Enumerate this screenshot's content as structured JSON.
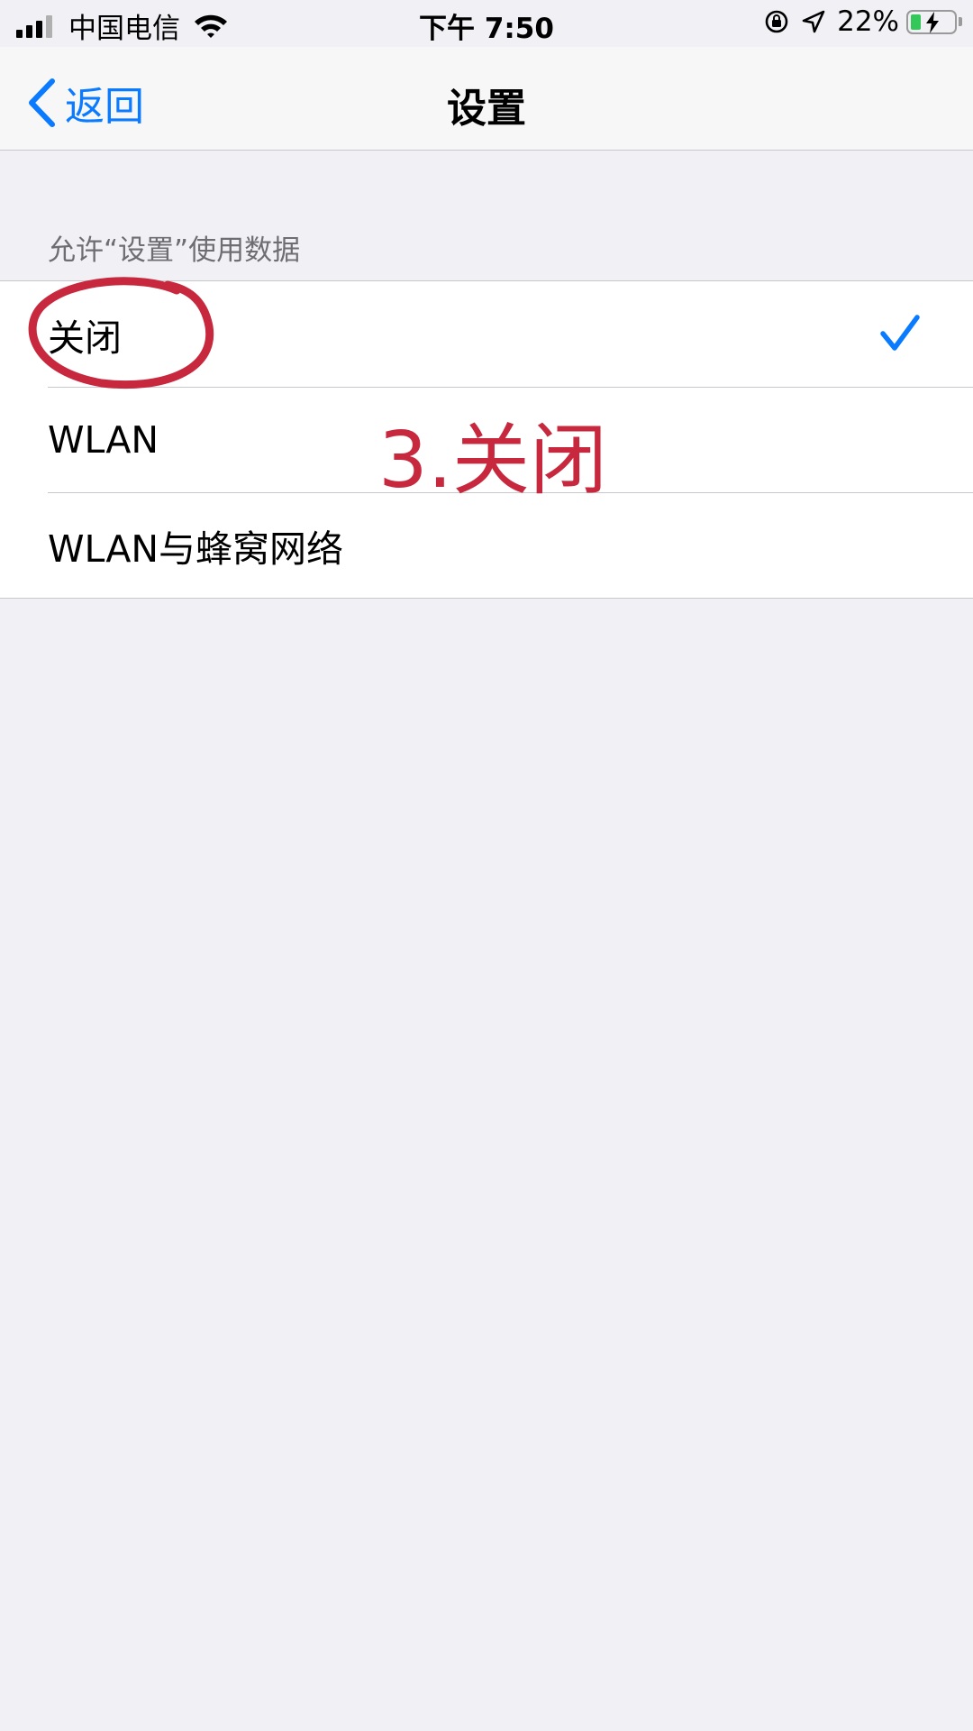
{
  "status_bar": {
    "carrier": "中国电信",
    "time": "下午 7:50",
    "battery_percent": "22%",
    "battery_level": 0.22,
    "signal_bars": 3
  },
  "nav": {
    "back_label": "返回",
    "title": "设置"
  },
  "section": {
    "header": "允许“设置”使用数据",
    "options": [
      {
        "label": "关闭",
        "selected": true
      },
      {
        "label": "WLAN",
        "selected": false
      },
      {
        "label": "WLAN与蜂窝网络",
        "selected": false
      }
    ]
  },
  "annotation": {
    "text": "3.关闭",
    "color": "#c8283d"
  },
  "colors": {
    "accent": "#0a7aff",
    "background": "#f0f0f5",
    "battery": "#34c759"
  }
}
